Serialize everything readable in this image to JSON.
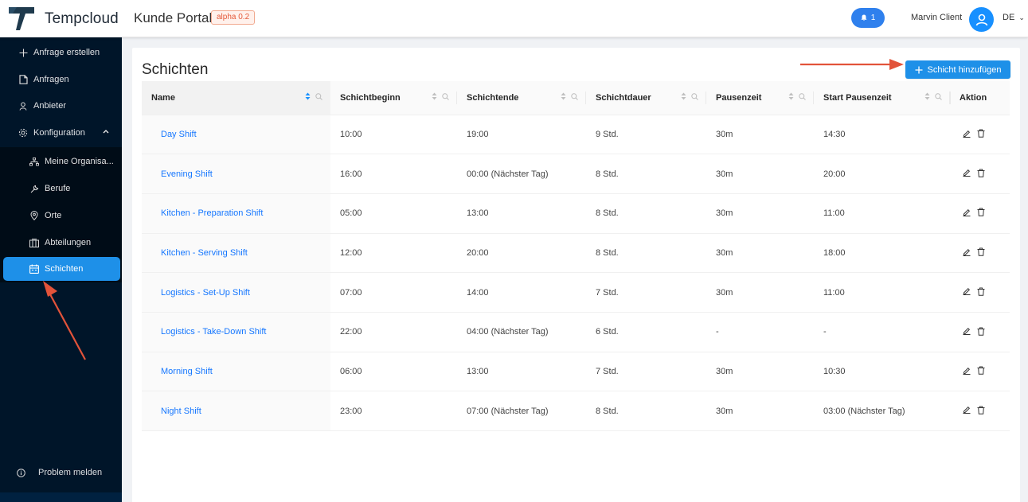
{
  "header": {
    "brand": "Tempcloud",
    "portal": "Kunde Portal",
    "badge": "alpha 0.2",
    "notifications": "1",
    "user": "Marvin Client",
    "language": "DE"
  },
  "sidebar": {
    "items": [
      {
        "label": "Anfrage erstellen",
        "icon": "plus-icon"
      },
      {
        "label": "Anfragen",
        "icon": "file-icon"
      },
      {
        "label": "Anbieter",
        "icon": "user-icon"
      },
      {
        "label": "Konfiguration",
        "icon": "gear-icon"
      },
      {
        "label": "Meine Organisa...",
        "icon": "org-icon"
      },
      {
        "label": "Berufe",
        "icon": "tool-icon"
      },
      {
        "label": "Orte",
        "icon": "location-icon"
      },
      {
        "label": "Abteilungen",
        "icon": "building-icon"
      },
      {
        "label": "Schichten",
        "icon": "calendar-icon"
      }
    ],
    "report": "Problem melden"
  },
  "main": {
    "title": "Schichten",
    "add_button": "Schicht hinzufügen",
    "columns": [
      "Name",
      "Schichtbeginn",
      "Schichtende",
      "Schichtdauer",
      "Pausenzeit",
      "Start Pausenzeit",
      "Aktion"
    ],
    "rows": [
      {
        "name": "Day Shift",
        "start": "10:00",
        "end": "19:00",
        "duration": "9 Std.",
        "pause": "30m",
        "pause_start": "14:30"
      },
      {
        "name": "Evening Shift",
        "start": "16:00",
        "end": "00:00 (Nächster Tag)",
        "duration": "8 Std.",
        "pause": "30m",
        "pause_start": "20:00"
      },
      {
        "name": "Kitchen - Preparation Shift",
        "start": "05:00",
        "end": "13:00",
        "duration": "8 Std.",
        "pause": "30m",
        "pause_start": "11:00"
      },
      {
        "name": "Kitchen - Serving Shift",
        "start": "12:00",
        "end": "20:00",
        "duration": "8 Std.",
        "pause": "30m",
        "pause_start": "18:00"
      },
      {
        "name": "Logistics - Set-Up Shift",
        "start": "07:00",
        "end": "14:00",
        "duration": "7 Std.",
        "pause": "30m",
        "pause_start": "11:00"
      },
      {
        "name": "Logistics - Take-Down Shift",
        "start": "22:00",
        "end": "04:00 (Nächster Tag)",
        "duration": "6 Std.",
        "pause": "-",
        "pause_start": "-"
      },
      {
        "name": "Morning Shift",
        "start": "06:00",
        "end": "13:00",
        "duration": "7 Std.",
        "pause": "30m",
        "pause_start": "10:30"
      },
      {
        "name": "Night Shift",
        "start": "23:00",
        "end": "07:00 (Nächster Tag)",
        "duration": "8 Std.",
        "pause": "30m",
        "pause_start": "03:00 (Nächster Tag)"
      }
    ]
  },
  "colors": {
    "accent": "#1e90e8",
    "sidebar": "#001529",
    "annotation": "#e2533a"
  }
}
